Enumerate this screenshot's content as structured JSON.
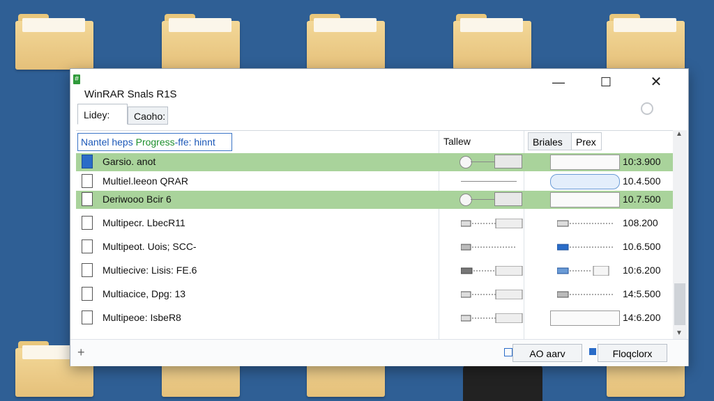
{
  "window": {
    "title": "WinRAR Snals R1S",
    "app_icon": "#",
    "controls": {
      "minimize": "—",
      "maximize": "☐",
      "close": "✕"
    }
  },
  "tabs": [
    {
      "label": "Lidey:"
    },
    {
      "label": "Caoho:"
    }
  ],
  "list": {
    "header": {
      "name_filter_prefix": "Nantel heps ",
      "name_filter_progress": "Progress",
      "name_filter_suffix": "-ffe: hinnt",
      "col_tallew": "Tallew",
      "btn_briales": "Briales",
      "btn_prex": "Prex"
    },
    "rows": [
      {
        "label": "Garsio. anot",
        "value": "10:3.900",
        "selected": true,
        "icon": "blue-file-icon"
      },
      {
        "label": "Multiel.leeon QRAR",
        "value": "10.4.500",
        "selected": false,
        "icon": "document-icon"
      },
      {
        "label": "Deriwooo Bcir 6",
        "value": "10.7.500",
        "selected": true,
        "icon": "document-icon"
      },
      {
        "label": "Multipecr. LbecR11",
        "value": "108.200",
        "selected": false,
        "icon": "document-icon"
      },
      {
        "label": "Multipeot. Uois; SCC-",
        "value": "10.6.500",
        "selected": false,
        "icon": "document-icon"
      },
      {
        "label": "Multiecive: Lisis: FE.6",
        "value": "10:6.200",
        "selected": false,
        "icon": "document-icon"
      },
      {
        "label": "Multiacice, Dpg: 13",
        "value": "14:5.500",
        "selected": false,
        "icon": "grid-file-icon"
      },
      {
        "label": "Multipeoe: IsbeR8",
        "value": "14:6.200",
        "selected": false,
        "icon": "archive-icon"
      }
    ]
  },
  "bottom": {
    "add_label": "AO aarv",
    "other_label": "Floqclorx"
  },
  "colors": {
    "selection": "#a9d39b",
    "accent": "#2a6cc8",
    "desktop": "#2f5f95"
  }
}
